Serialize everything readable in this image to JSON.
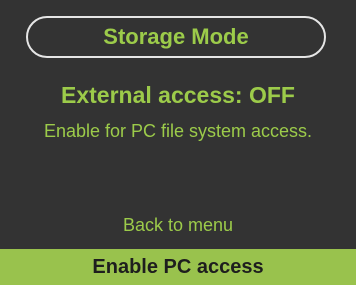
{
  "header": {
    "title": "Storage Mode"
  },
  "status": {
    "text": "External access: OFF"
  },
  "description": {
    "text": "Enable for PC file system access."
  },
  "menu": {
    "items": [
      {
        "label": "Back to menu",
        "selected": false
      },
      {
        "label": "Enable PC access",
        "selected": true
      }
    ]
  },
  "colors": {
    "background": "#333333",
    "accent": "#9ccb4a",
    "highlight": "#99c24d",
    "border": "#e6e6e6",
    "selected_text": "#1e1e1e"
  }
}
